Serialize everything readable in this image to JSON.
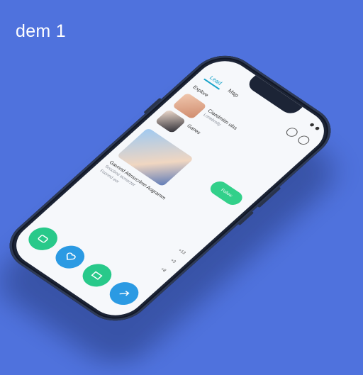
{
  "caption": "dem 1",
  "colors": {
    "background": "#4f72dd",
    "phone_body": "#1c2436",
    "accent_green": "#28c98a",
    "accent_blue": "#2b9ae3",
    "tab_active": "#17a3c9"
  },
  "topbar": {
    "tabs": [
      "Lead",
      "Map"
    ],
    "icons": [
      "search-icon",
      "bell-icon"
    ]
  },
  "feed": {
    "header": "Explore",
    "items": [
      {
        "title": "Ciaodmitin ulss",
        "subtitle": "Lonebrolly"
      },
      {
        "title": "Ganes",
        "subtitle": ""
      }
    ],
    "pill_label": "Follow"
  },
  "card": {
    "title": "Gavnnd Attnsrcrlmn Aogramm",
    "lines": [
      "Snccbnd acmsrzer",
      "Fsonnd eor"
    ]
  },
  "meta_values": [
    "+13",
    "+3",
    "+8"
  ],
  "actions": [
    {
      "icon": "chat-icon"
    },
    {
      "icon": "heart-icon"
    },
    {
      "icon": "cart-icon"
    },
    {
      "icon": "share-icon"
    }
  ]
}
